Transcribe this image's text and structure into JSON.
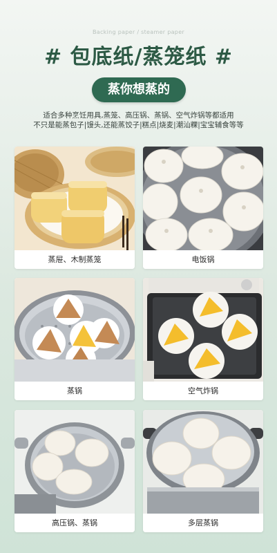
{
  "header": {
    "subtitle": "Backing paper / steamer paper",
    "title": "# 包底纸/蒸笼纸 #",
    "pill": "蒸你想蒸的",
    "desc_line1": "适合多种烹饪用具,蒸笼、高压锅、蒸锅、空气炸锅等都适用",
    "desc_line2": "不只是能蒸包子|馒头,还能蒸饺子|糕点|烧麦|潮汕粿|宝宝辅食等等"
  },
  "cards": [
    {
      "label": "蒸屉、木制蒸笼",
      "icon": "bamboo-steamer-photo"
    },
    {
      "label": "电饭锅",
      "icon": "rice-cooker-photo"
    },
    {
      "label": "蒸锅",
      "icon": "steam-pot-photo"
    },
    {
      "label": "空气炸锅",
      "icon": "air-fryer-photo"
    },
    {
      "label": "高压锅、蒸锅",
      "icon": "pressure-cooker-photo"
    },
    {
      "label": "多层蒸锅",
      "icon": "multi-layer-steamer-photo"
    }
  ],
  "colors": {
    "brand_green": "#2f6a52",
    "title_green": "#2d5a45",
    "steamed_bun": "#f3efe6",
    "mantou_yellow": "#f2d27a",
    "pumpkin_dough": "#f4b73a",
    "bamboo": "#d9b77a"
  }
}
